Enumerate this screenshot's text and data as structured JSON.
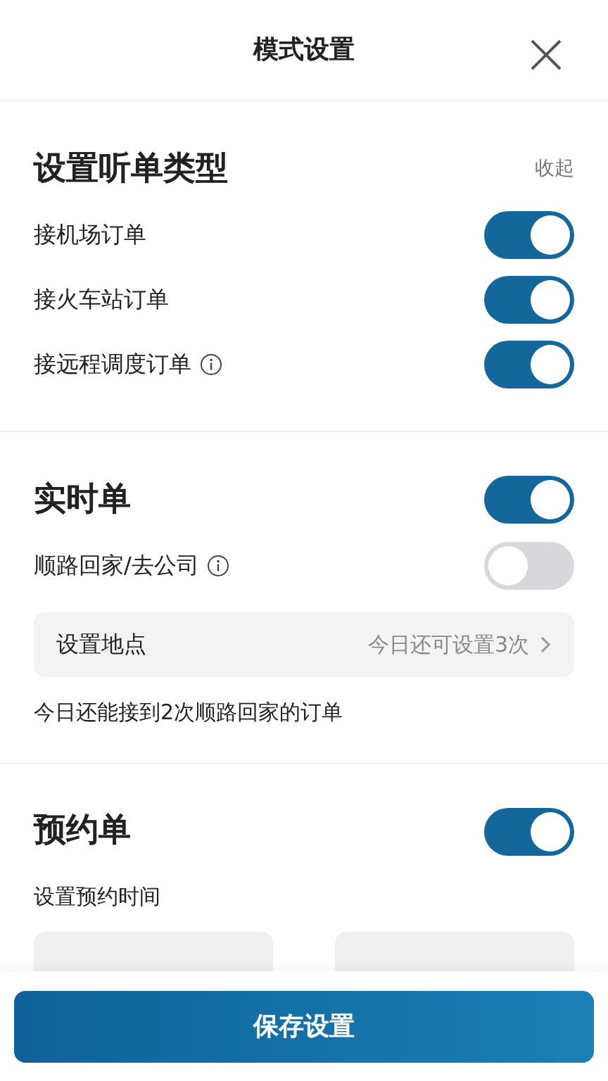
{
  "header": {
    "title": "模式设置"
  },
  "sections": [
    {
      "title": "设置听单类型",
      "action": "收起",
      "items": [
        {
          "kind": "toggle",
          "label": "接机场订单",
          "info": false,
          "on": true
        },
        {
          "kind": "toggle",
          "label": "接火车站订单",
          "info": false,
          "on": true
        },
        {
          "kind": "toggle",
          "label": "接远程调度订单",
          "info": true,
          "on": true
        }
      ]
    },
    {
      "title": "实时单",
      "on": true,
      "items": [
        {
          "kind": "toggle",
          "label": "顺路回家/去公司",
          "info": true,
          "on": false
        },
        {
          "kind": "link",
          "label": "设置地点",
          "value": "今日还可设置3次"
        },
        {
          "kind": "note",
          "label": "今日还能接到2次顺路回家的订单"
        }
      ]
    },
    {
      "title": "预约单",
      "on": true,
      "items": [
        {
          "kind": "label",
          "label": "设置预约时间"
        },
        {
          "kind": "time_fields"
        }
      ]
    }
  ],
  "save_button": "保存设置"
}
